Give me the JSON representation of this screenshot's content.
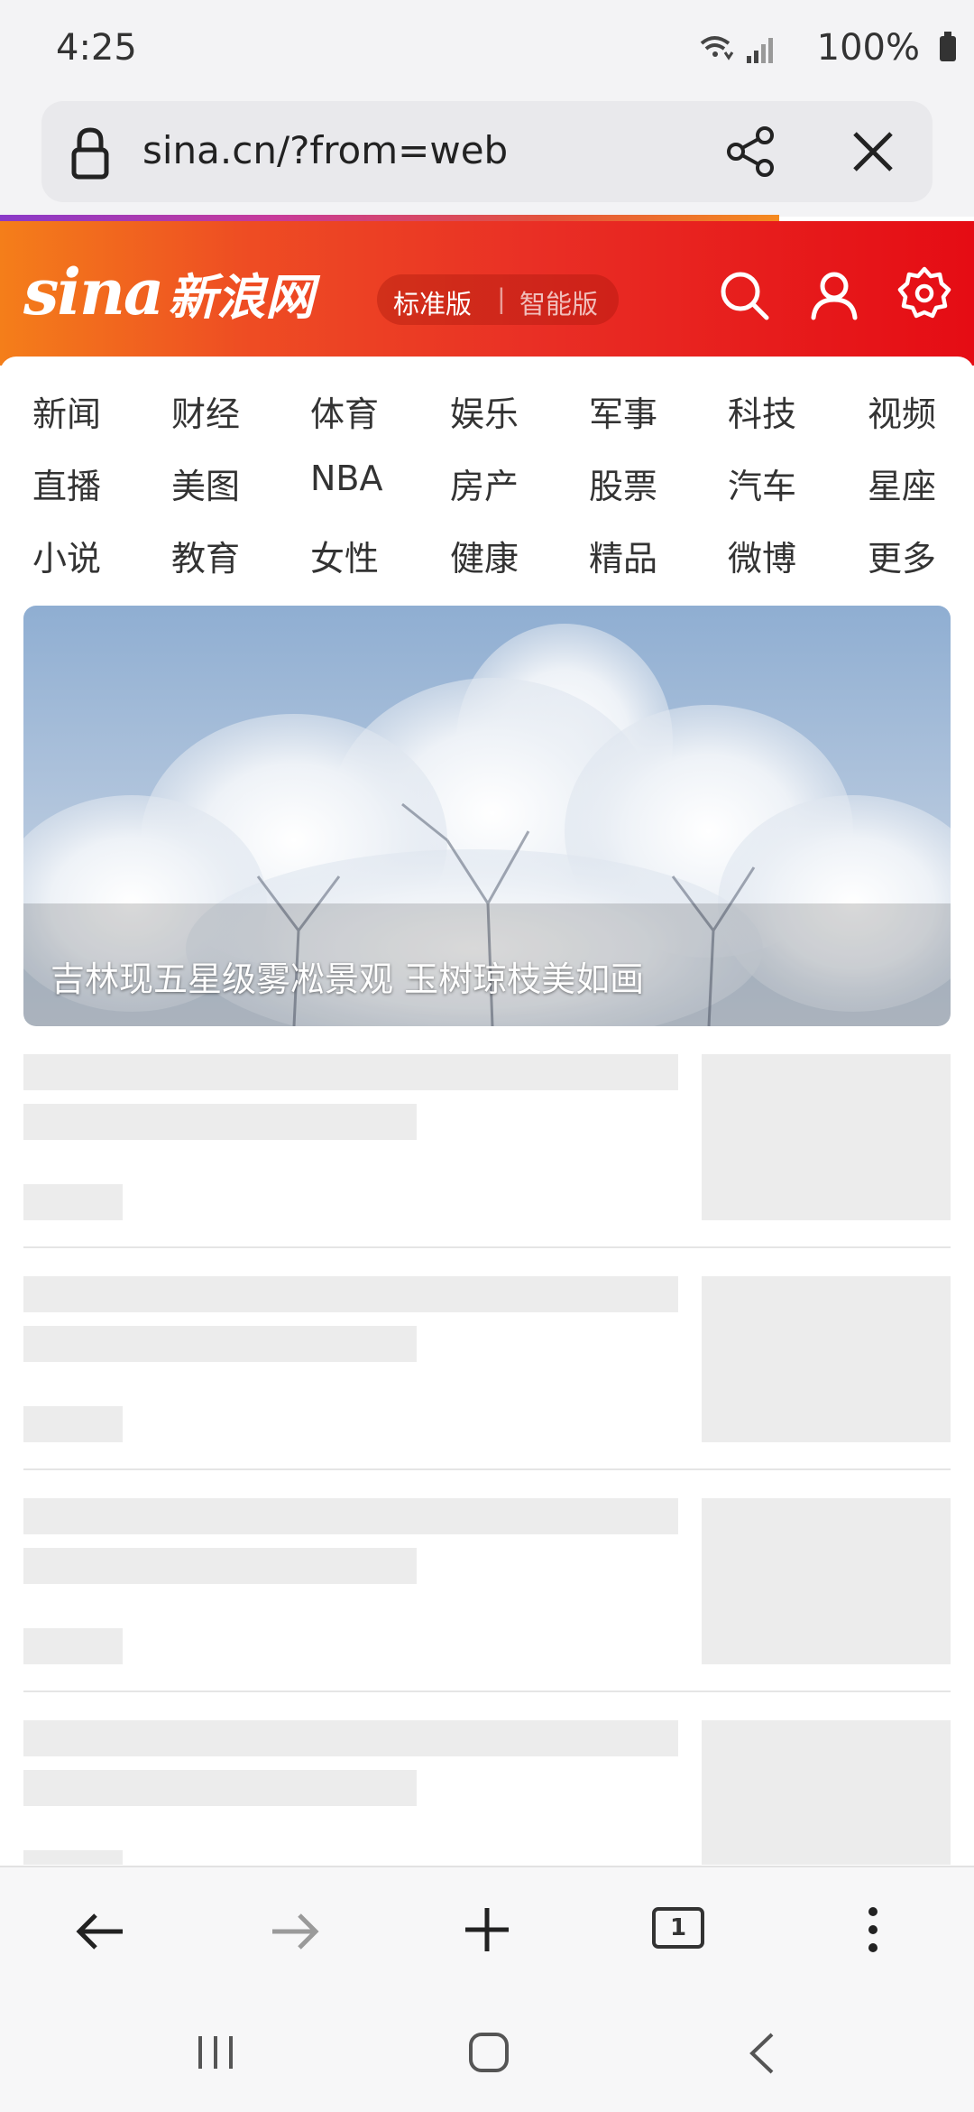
{
  "status_bar": {
    "time": "4:25",
    "battery": "100%"
  },
  "browser": {
    "url": "sina.cn/?from=web",
    "tab_count": "1"
  },
  "sina_header": {
    "logo_en": "sina",
    "logo_cn": "新浪网",
    "version_standard": "标准版",
    "version_separator": "|",
    "version_smart": "智能版"
  },
  "nav": {
    "items": [
      "新闻",
      "财经",
      "体育",
      "娱乐",
      "军事",
      "科技",
      "视频",
      "直播",
      "美图",
      "NBA",
      "房产",
      "股票",
      "汽车",
      "星座",
      "小说",
      "教育",
      "女性",
      "健康",
      "精品",
      "微博",
      "更多"
    ]
  },
  "hero": {
    "caption": "吉林现五星级雾凇景观 玉树琼枝美如画"
  },
  "colors": {
    "brand_red": "#e50c14",
    "brand_orange": "#f47e1a"
  },
  "icons": [
    "lock-icon",
    "share-icon",
    "close-icon",
    "search-icon",
    "user-icon",
    "gear-icon",
    "back-arrow-icon",
    "forward-arrow-icon",
    "add-icon",
    "tabs-icon",
    "more-icon",
    "recents-icon",
    "home-icon",
    "system-back-icon"
  ]
}
